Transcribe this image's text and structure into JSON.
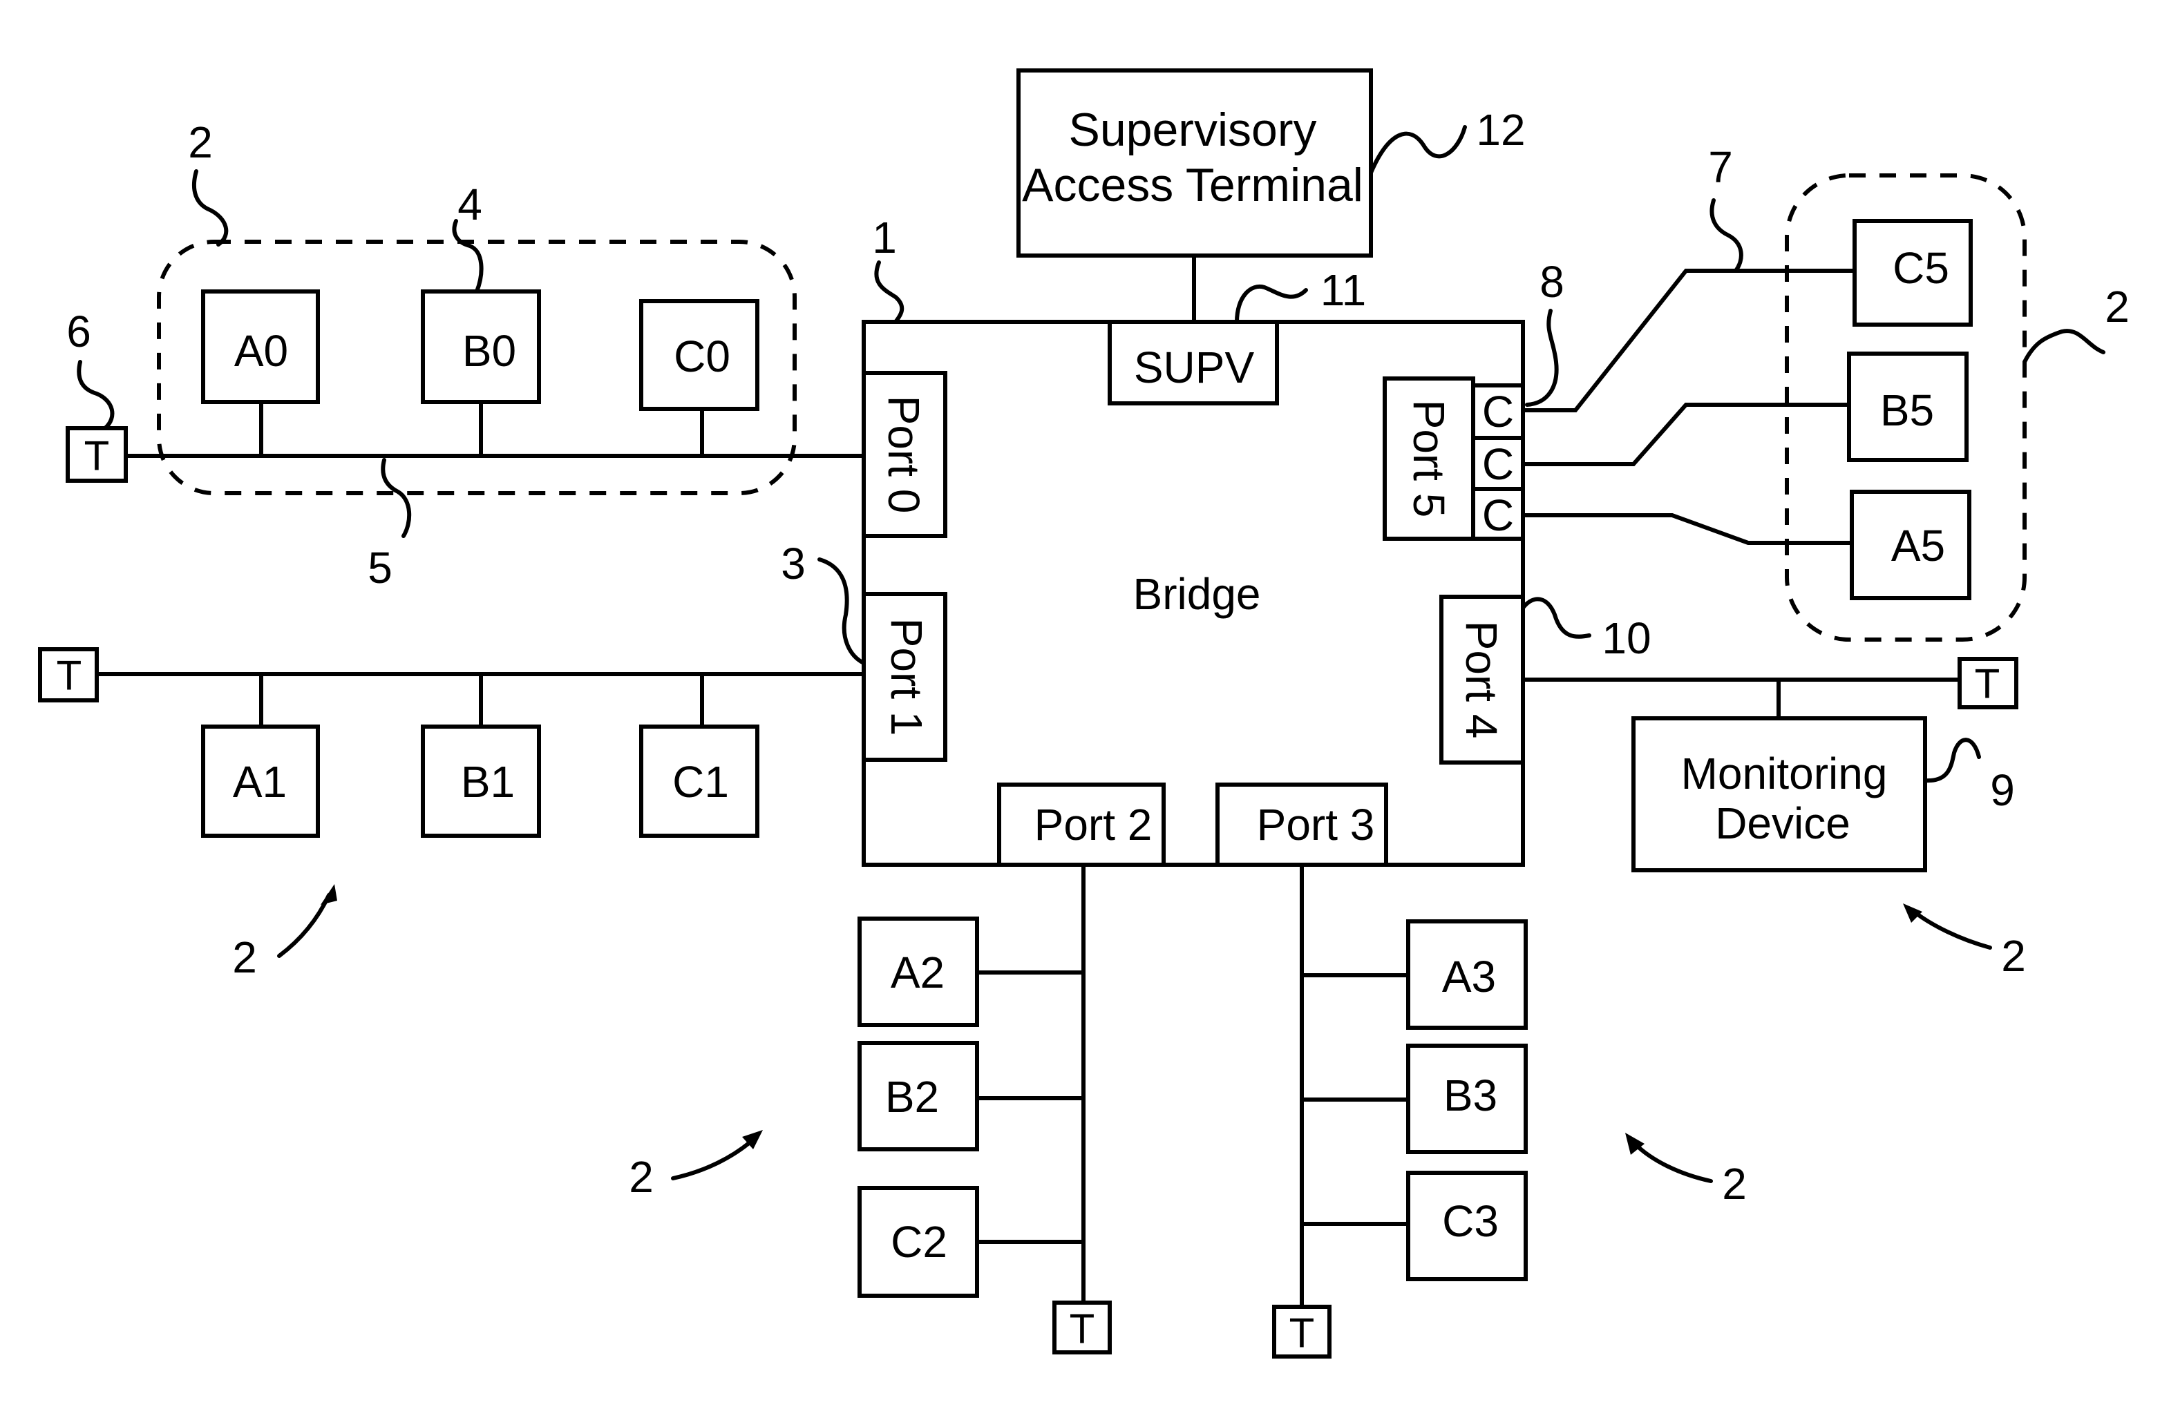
{
  "diagram": {
    "bridge": {
      "label": "Bridge",
      "ref": "1"
    },
    "supv": {
      "label": "SUPV",
      "ref": "11"
    },
    "supervisory_terminal": {
      "line1": "Supervisory",
      "line2": "Access Terminal",
      "ref": "12"
    },
    "ports": {
      "port0": "Port 0",
      "port1": "Port 1",
      "port2": "Port 2",
      "port3": "Port 3",
      "port4": "Port 4",
      "port5": "Port 5"
    },
    "connectors": [
      "C",
      "C",
      "C"
    ],
    "connector_ref": "8",
    "monitoring_device": {
      "line1": "Monitoring",
      "line2": "Device",
      "ref": "9"
    },
    "terminator_label": "T",
    "segments": {
      "seg0": [
        "A0",
        "B0",
        "C0"
      ],
      "seg1": [
        "A1",
        "B1",
        "C1"
      ],
      "seg2": [
        "A2",
        "B2",
        "C2"
      ],
      "seg3": [
        "A3",
        "B3",
        "C3"
      ],
      "seg5": [
        "C5",
        "B5",
        "A5"
      ]
    },
    "refs": {
      "segment": "2",
      "port_ref": "3",
      "station": "4",
      "bus": "5",
      "terminator": "6",
      "link": "7",
      "port4_ref": "10"
    }
  }
}
